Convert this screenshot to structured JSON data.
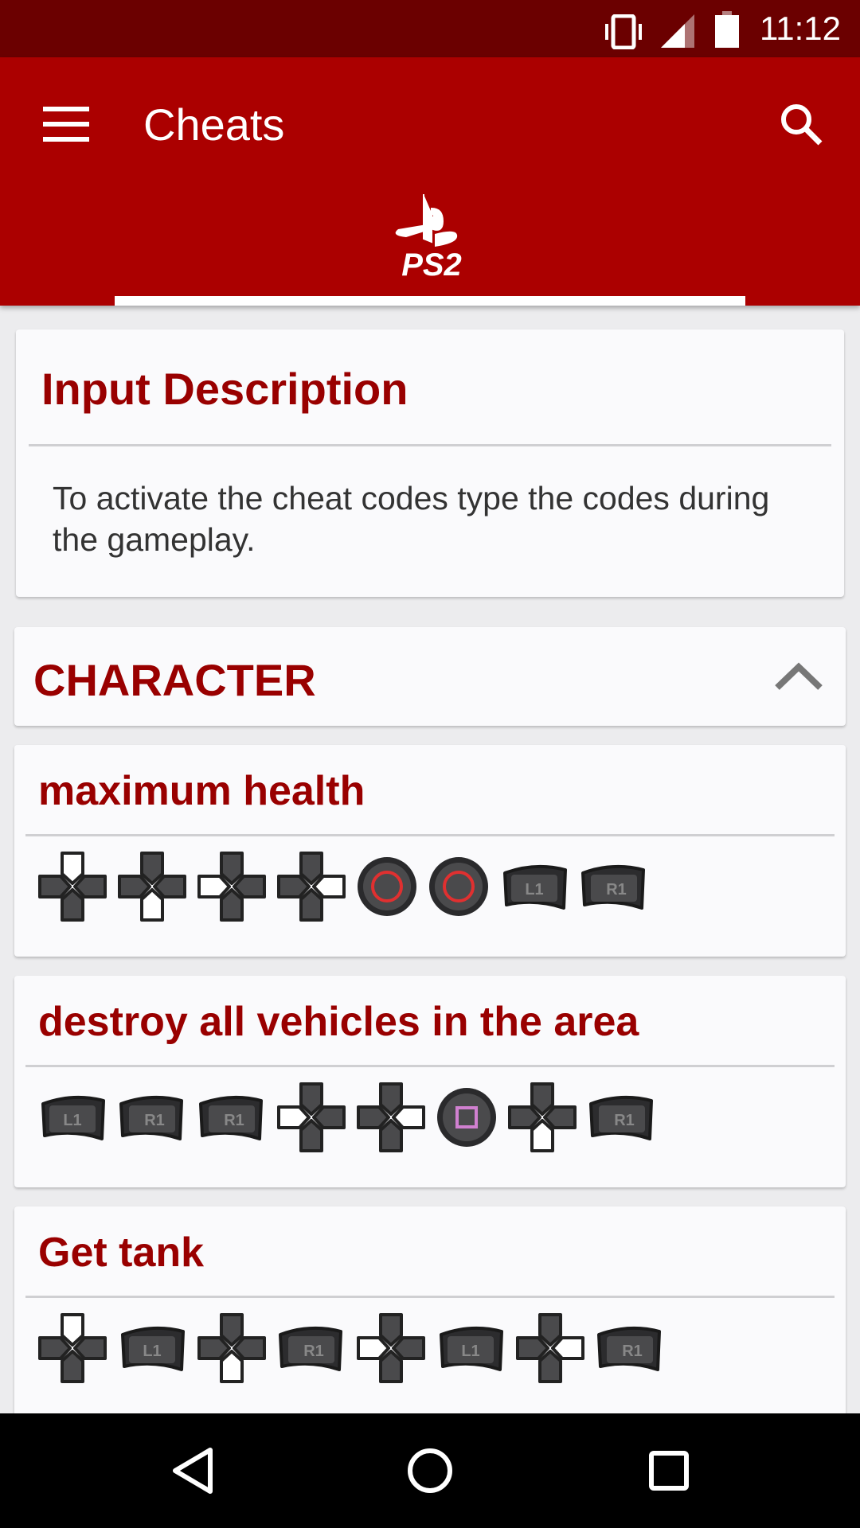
{
  "status_bar": {
    "time": "11:12",
    "icons": [
      "vibrate-icon",
      "signal-icon",
      "battery-icon"
    ]
  },
  "app_bar": {
    "title": "Cheats",
    "menu_icon": "hamburger-menu-icon",
    "search_icon": "search-icon",
    "platform_tab": "PS2"
  },
  "input_description": {
    "title": "Input Description",
    "text": "To activate the cheat codes type the codes during the gameplay."
  },
  "section": {
    "title": "CHARACTER",
    "expanded": true
  },
  "cheats": [
    {
      "name": "maximum health",
      "inputs": [
        "up",
        "down",
        "left",
        "right",
        "circle",
        "circle",
        "L1",
        "R1"
      ]
    },
    {
      "name": "destroy all vehicles in the area",
      "inputs": [
        "L1",
        "R1",
        "R1",
        "left",
        "right",
        "square",
        "down",
        "R1"
      ]
    },
    {
      "name": "Get tank",
      "inputs": [
        "up",
        "L1",
        "down",
        "R1",
        "left",
        "L1",
        "right",
        "R1"
      ]
    }
  ],
  "colors": {
    "status_bar": "#6b0000",
    "app_bar": "#ab0000",
    "title_text": "#990000",
    "circle": "#e03030",
    "square": "#d080d0"
  },
  "nav_bar": {
    "buttons": [
      "back",
      "home",
      "recents"
    ]
  }
}
